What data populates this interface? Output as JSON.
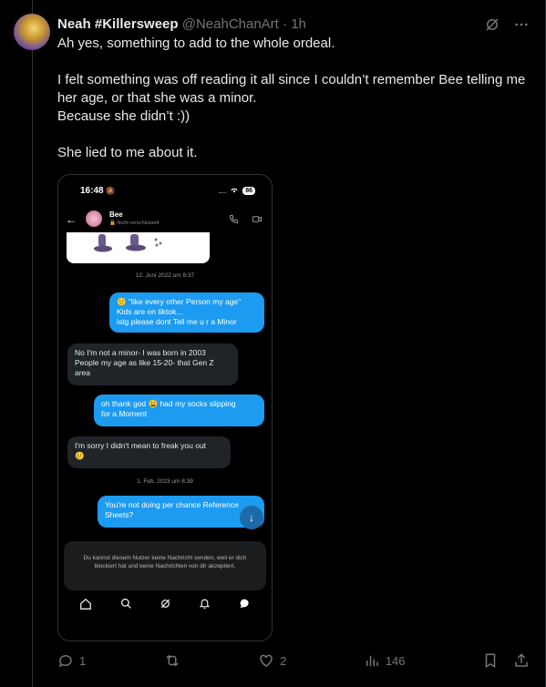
{
  "post": {
    "display_name": "Neah #Killersweep",
    "handle": "@NeahChanArt",
    "separator": "·",
    "time": "1h",
    "text": [
      "Ah yes, something to add to the whole ordeal.",
      "",
      "I felt something was off reading it all since I couldn’t remember Bee telling me her age, or that she was a minor.",
      "Because she didn’t :))",
      "",
      "She lied to me about it."
    ]
  },
  "screenshot": {
    "status_time": "16:48",
    "status_dots": "....",
    "battery": "86",
    "contact_name": "Bee",
    "contact_sub": "Nicht verschlüsselt",
    "stamp1": "12. Juni 2022 um 8:37",
    "messages": [
      {
        "dir": "out",
        "lines": [
          "🙂 \"like every other Person my age\"",
          "Kids are on tiktok…",
          "istg please dont Tell me u r a Minor"
        ]
      },
      {
        "dir": "in",
        "lines": [
          "No I'm not a minor- I was born in 2003",
          "People my age as like 15-20- that Gen Z",
          "area"
        ]
      },
      {
        "dir": "out",
        "lines": [
          "oh thank god 😩 had my socks slipping",
          "for a Moment"
        ]
      },
      {
        "dir": "in",
        "lines": [
          "I'm sorry I didn't mean to freak you out",
          "🥲"
        ]
      },
      {
        "dir": "out",
        "lines": [
          "You're not doing per chance Reference",
          "Sheets?"
        ]
      }
    ],
    "stamp2": "1. Feb. 2023 um 8:39",
    "blocked_text": "Du kannst diesem Nutzer keine Nachricht senden, weil er dich blockiert hat und keine Nachrichten von dir akzeptiert."
  },
  "actions": {
    "replies": "1",
    "likes": "2",
    "views": "146"
  },
  "icons": [
    "grok-icon",
    "more-icon",
    "reply-icon",
    "retweet-icon",
    "like-icon",
    "views-icon",
    "bookmark-icon",
    "share-icon"
  ]
}
